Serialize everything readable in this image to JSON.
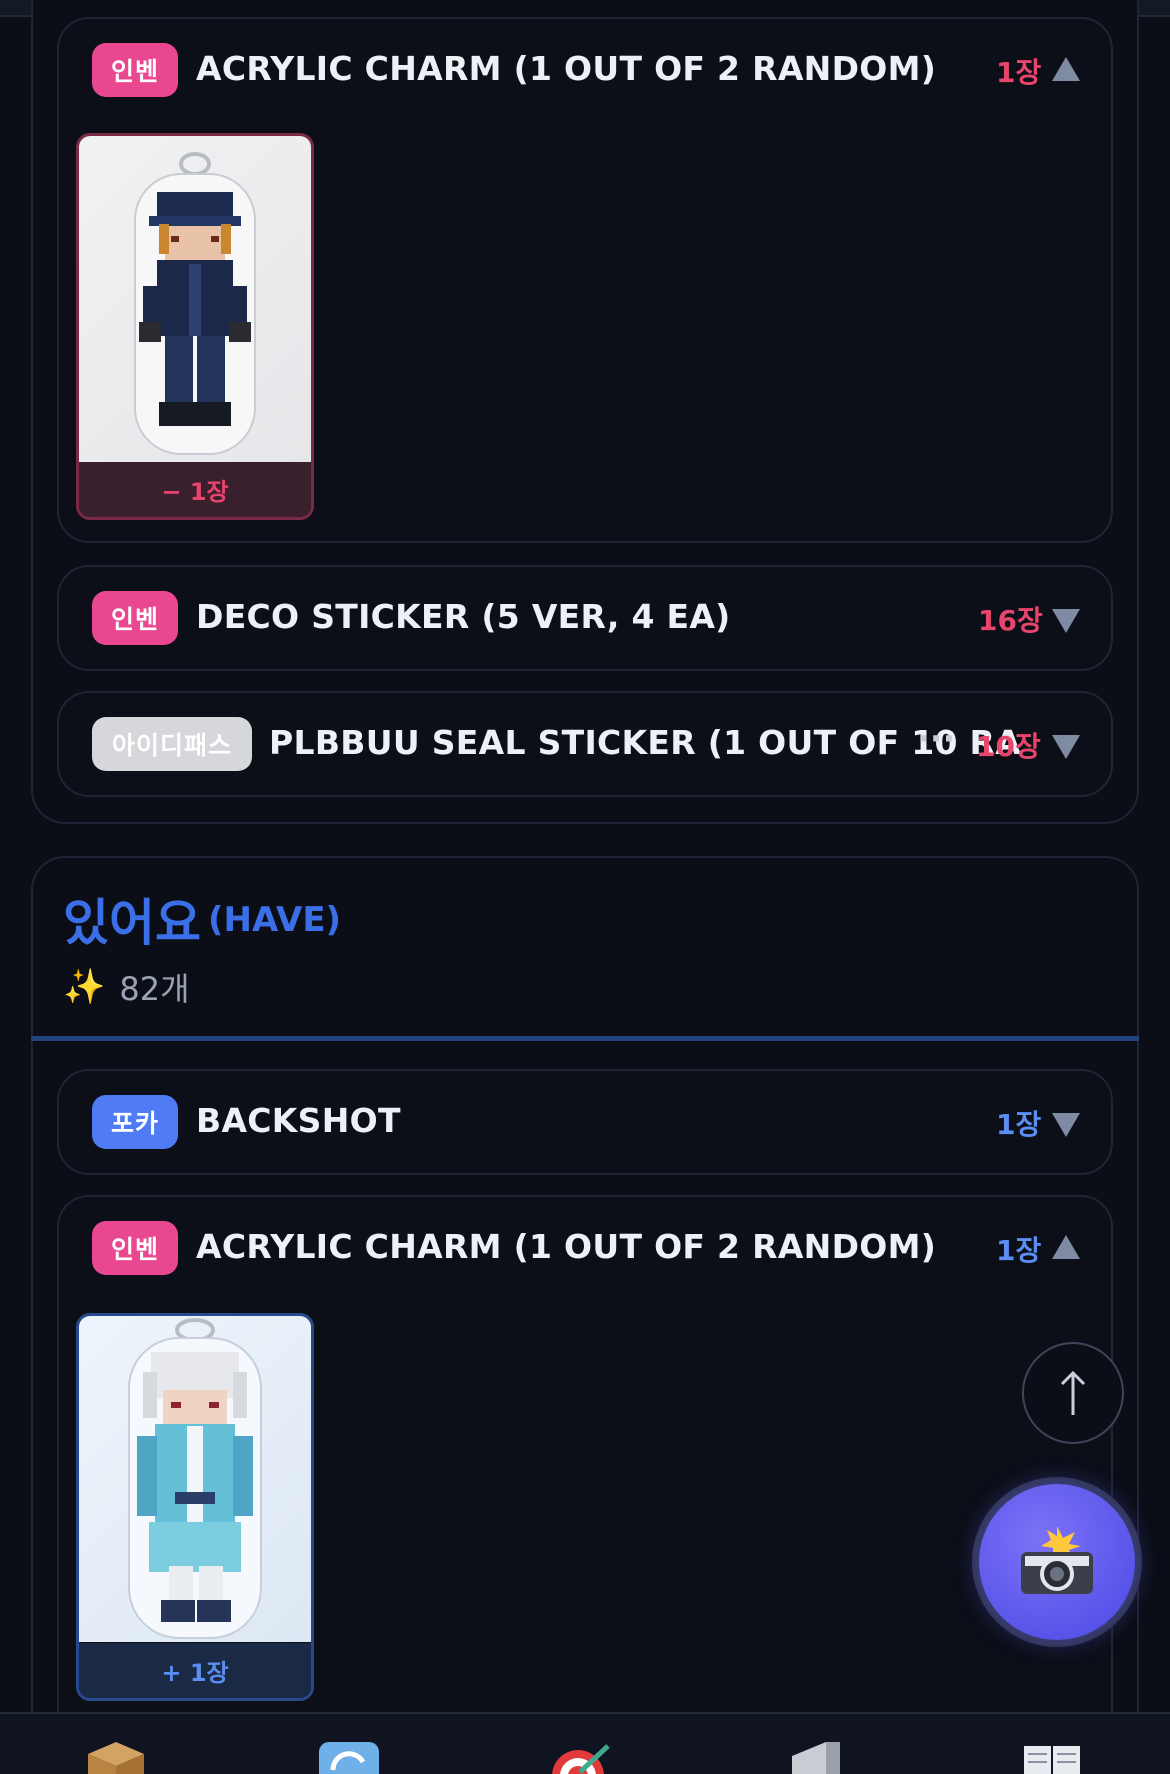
{
  "want_section": {
    "items": [
      {
        "badge": "인벤",
        "title": "ACRYLIC CHARM (1 OUT OF 2 RANDOM)",
        "count": "1장",
        "thumb_label": "− 1장"
      },
      {
        "badge": "인벤",
        "title": "DECO STICKER (5 VER, 4 EA)",
        "count": "16장"
      },
      {
        "badge": "아이디패스",
        "title": "PLBBUU SEAL STICKER (1 OUT OF 10 RA",
        "more": "···",
        "count": "10장"
      }
    ]
  },
  "have_section": {
    "title": "있어요",
    "subtitle": "(HAVE)",
    "count": "82개",
    "items": [
      {
        "badge": "포카",
        "title": "BACKSHOT",
        "count": "1장"
      },
      {
        "badge": "인벤",
        "title": "ACRYLIC CHARM (1 OUT OF 2 RANDOM)",
        "count": "1장",
        "thumb_label": "+ 1장"
      }
    ]
  },
  "icons": {
    "sparkle": "sparkle-icon",
    "expand": "chevron-down-icon",
    "collapse": "chevron-up-icon",
    "scroll_top": "arrow-up-icon",
    "camera": "camera-flash-icon"
  },
  "bottom_nav": [
    "package-icon",
    "refresh-icon",
    "target-icon",
    "megaphone-icon",
    "book-icon"
  ],
  "colors": {
    "background": "#0b0e16",
    "pink_badge": "#ea4791",
    "blue_badge": "#4f7bf5",
    "gray_badge": "#d6d7db",
    "want_count": "#e8456d",
    "have_count": "#5a8ef2",
    "have_title": "#3b6fe8",
    "fab": "#5a55ea"
  }
}
